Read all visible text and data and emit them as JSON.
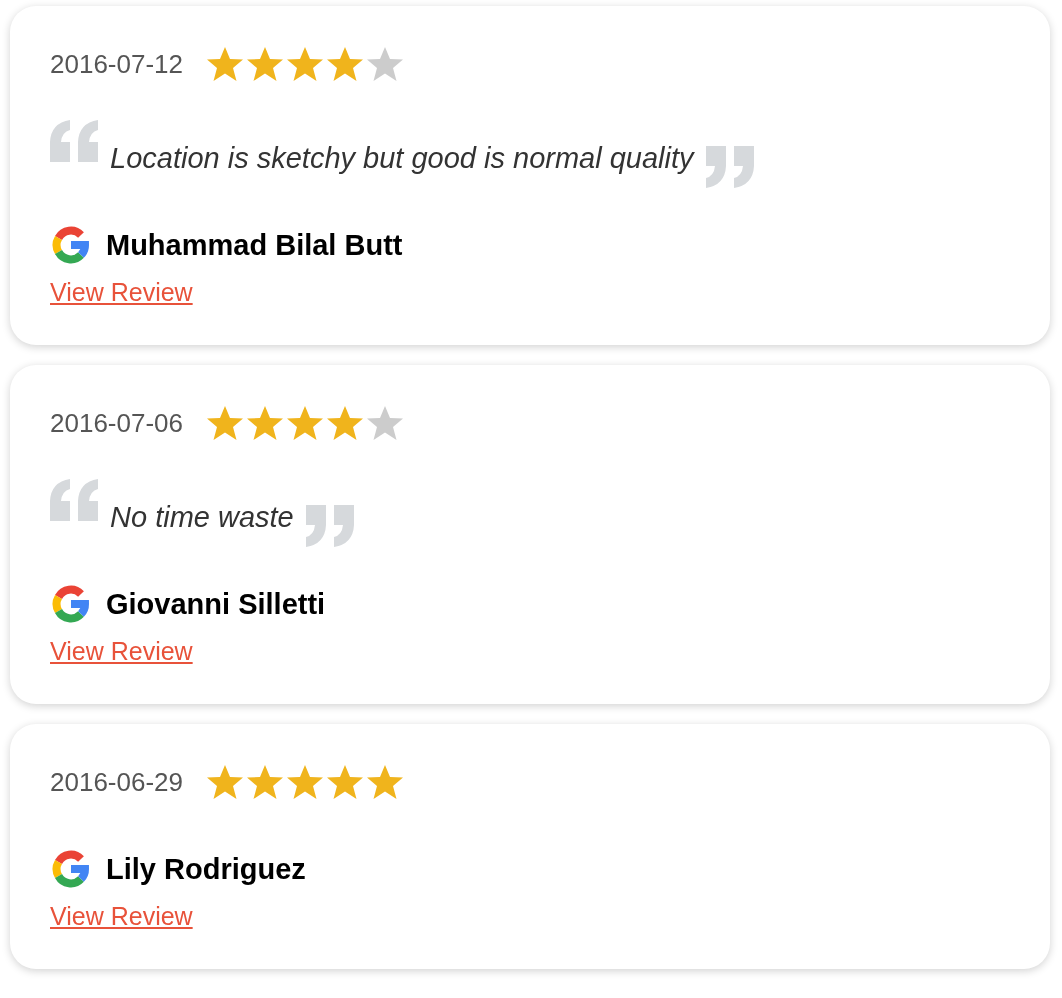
{
  "reviews": [
    {
      "date": "2016-07-12",
      "stars": 4,
      "quote": "Location is sketchy but good is normal quality",
      "author": "Muhammad Bilal Butt",
      "link": "View Review"
    },
    {
      "date": "2016-07-06",
      "stars": 4,
      "quote": "No time waste",
      "author": "Giovanni Silletti",
      "link": "View Review"
    },
    {
      "date": "2016-06-29",
      "stars": 5,
      "author": "Lily Rodriguez",
      "link": "View Review"
    }
  ]
}
